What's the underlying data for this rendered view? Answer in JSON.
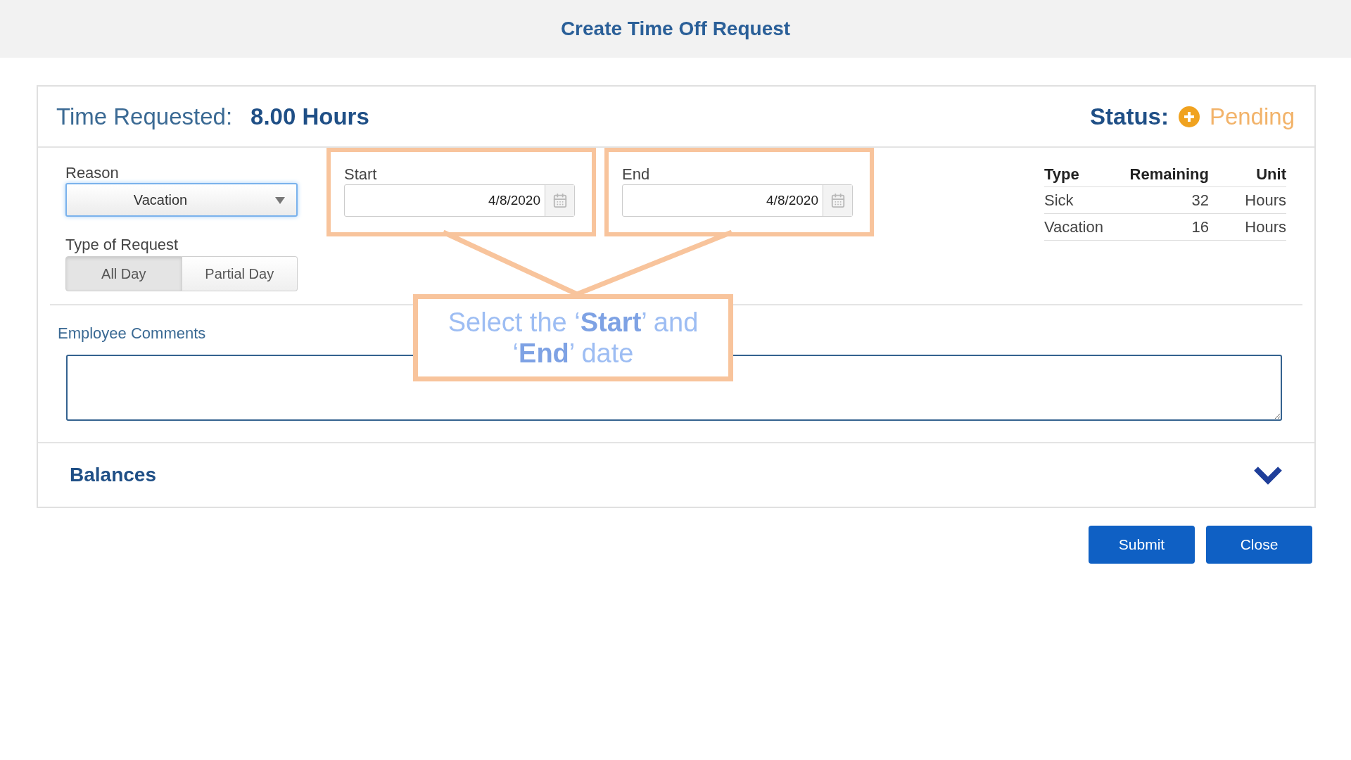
{
  "header": {
    "title": "Create Time Off Request"
  },
  "summary": {
    "label": "Time Requested:",
    "value": "8.00 Hours",
    "status_label": "Status:",
    "status": "Pending"
  },
  "reason": {
    "label": "Reason",
    "value": "Vacation"
  },
  "request_type": {
    "label": "Type of Request",
    "options": [
      {
        "label": "All Day",
        "selected": true
      },
      {
        "label": "Partial Day",
        "selected": false
      }
    ]
  },
  "dates": [
    {
      "label": "Start",
      "value": "4/8/2020",
      "highlighted": true
    },
    {
      "label": "End",
      "value": "4/8/2020",
      "highlighted": true
    }
  ],
  "balances_table": {
    "columns": [
      "Type",
      "Remaining",
      "Unit"
    ],
    "rows": [
      [
        "Sick",
        "32",
        "Hours"
      ],
      [
        "Vacation",
        "16",
        "Hours"
      ]
    ]
  },
  "comments": {
    "label": "Employee Comments"
  },
  "balances_section": {
    "title": "Balances",
    "expanded": false
  },
  "buttons": [
    "Submit",
    "Close"
  ],
  "callout": {
    "text": "Select the ‘**Start**’ and ‘**End**’ date"
  }
}
